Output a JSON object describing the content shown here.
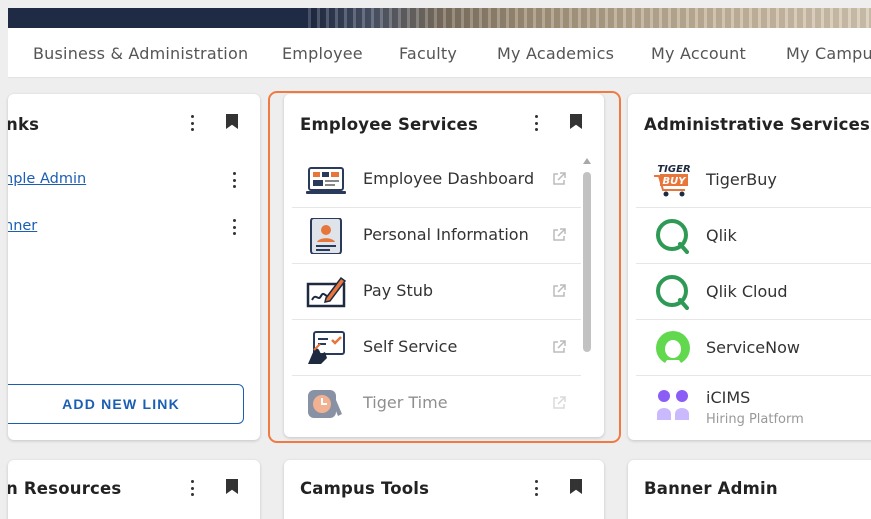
{
  "nav": {
    "items": [
      "Business & Administration",
      "Employee",
      "Faculty",
      "My Academics",
      "My Account",
      "My Campus"
    ]
  },
  "links_card": {
    "title": "nks",
    "links": [
      "nple Admin",
      "nner"
    ],
    "add_button": "ADD NEW LINK"
  },
  "employee_services": {
    "title": "Employee Services",
    "items": [
      {
        "label": "Employee Dashboard",
        "icon": "dashboard-icon"
      },
      {
        "label": "Personal Information",
        "icon": "id-card-icon"
      },
      {
        "label": "Pay Stub",
        "icon": "check-sign-icon"
      },
      {
        "label": "Self Service",
        "icon": "touch-screen-icon"
      },
      {
        "label": "Tiger Time",
        "icon": "clock-icon"
      }
    ]
  },
  "admin_services": {
    "title": "Administrative Services",
    "items": [
      {
        "label": "TigerBuy",
        "icon": "tigerbuy-logo",
        "logo_text": "TIGER BUY"
      },
      {
        "label": "Qlik",
        "icon": "qlik-logo"
      },
      {
        "label": "Qlik Cloud",
        "icon": "qlik-logo"
      },
      {
        "label": "ServiceNow",
        "icon": "servicenow-logo"
      },
      {
        "label": "iCIMS",
        "sublabel": "Hiring Platform",
        "icon": "icims-logo"
      }
    ]
  },
  "bottom_cards": {
    "left_title": "n Resources",
    "middle_title": "Campus Tools",
    "right_title": "Banner Admin"
  },
  "colors": {
    "accent": "#f07a42",
    "link": "#1a5fb4",
    "qlik_green": "#2f9a55",
    "servicenow_green": "#62d84e",
    "icims_purple": "#8b5cf6"
  }
}
